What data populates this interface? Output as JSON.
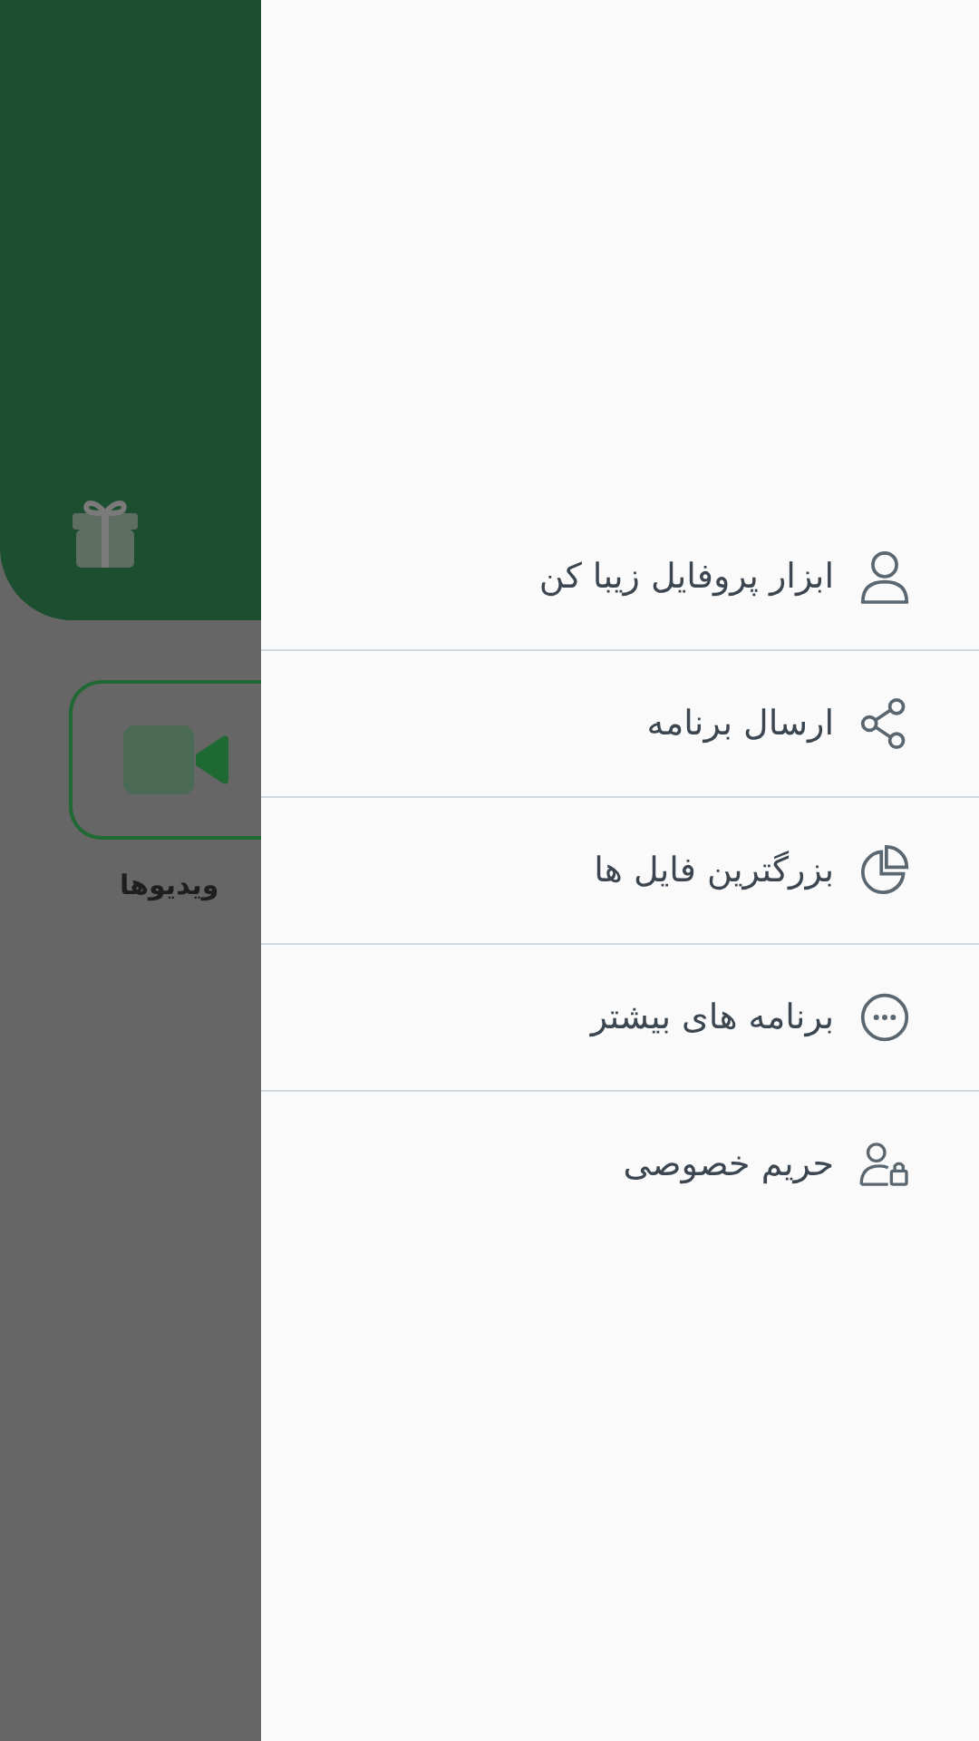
{
  "background": {
    "video_label": "ویدیوها"
  },
  "menu": {
    "items": [
      {
        "label": "ابزار پروفایل زیبا کن",
        "kind": "profile"
      },
      {
        "label": "ارسال برنامه",
        "kind": "share"
      },
      {
        "label": "بزرگترین فایل ها",
        "kind": "pie"
      },
      {
        "label": "برنامه های بیشتر",
        "kind": "more"
      },
      {
        "label": "حریم خصوصی",
        "kind": "privacy"
      }
    ]
  }
}
